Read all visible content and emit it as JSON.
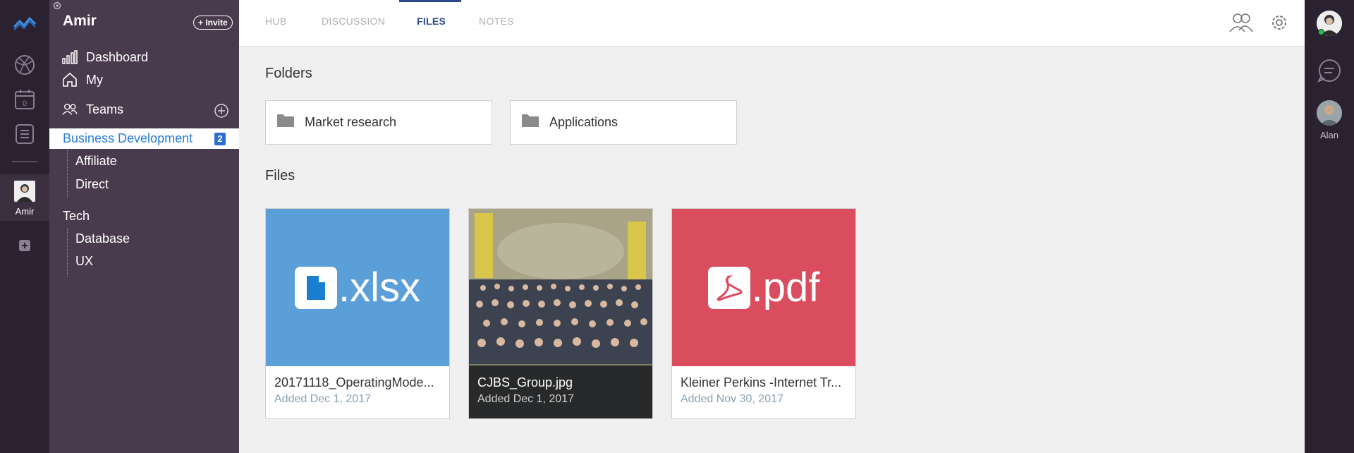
{
  "rail": {
    "calendar_count": "0",
    "user_name": "Amir"
  },
  "sidebar": {
    "title": "Amir",
    "invite_label": "+ Invite",
    "dashboard_label": "Dashboard",
    "my_label": "My",
    "teams_label": "Teams",
    "active_team": {
      "label": "Business Development",
      "badge": "2"
    },
    "business_children": [
      "Affiliate",
      "Direct"
    ],
    "tech": {
      "label": "Tech",
      "children": [
        "Database",
        "UX"
      ]
    }
  },
  "tabs": [
    "HUB",
    "DISCUSSION",
    "FILES",
    "NOTES"
  ],
  "active_tab": "FILES",
  "main": {
    "folders_heading": "Folders",
    "folders": [
      "Market research",
      "Applications"
    ],
    "files_heading": "Files",
    "files": [
      {
        "name": "20171118_OperatingMode...",
        "date": "Added Dec 1, 2017",
        "ext": ".xlsx",
        "color": "#5b9fd8"
      },
      {
        "name": "CJBS_Group.jpg",
        "date": "Added Dec 1, 2017",
        "ext": "",
        "color": "#6a7a5a"
      },
      {
        "name": "Kleiner Perkins -Internet Tr...",
        "date": "Added Nov 30, 2017",
        "ext": ".pdf",
        "color": "#d94d5f"
      }
    ]
  },
  "right_rail": {
    "user_name": "Alan"
  },
  "colors": {
    "sidebar": "#4a3a4e",
    "rail": "#2a2230",
    "accent": "#2a7bd8",
    "active_tab": "#2b4a8a"
  }
}
